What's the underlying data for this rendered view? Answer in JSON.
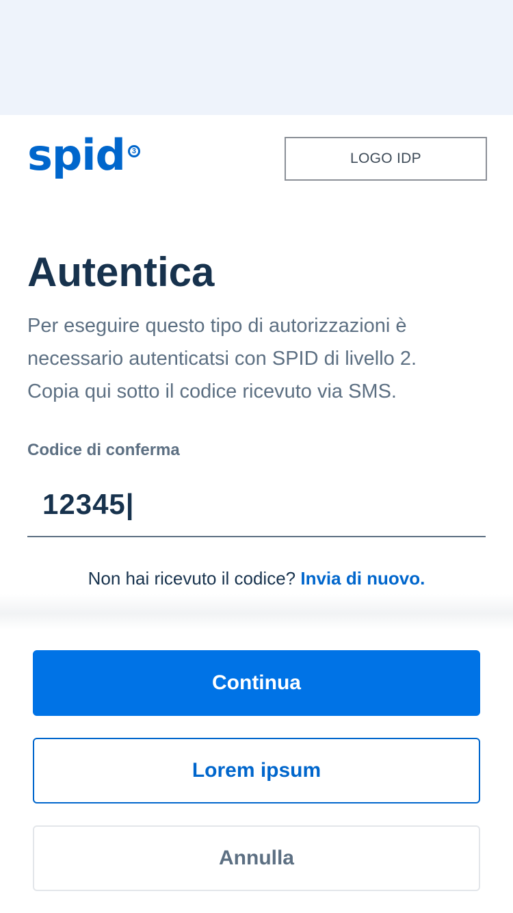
{
  "header": {
    "spid_logo_text": "spid",
    "spid_level": "3",
    "idp_logo_label": "LOGO IDP"
  },
  "main": {
    "title": "Autentica",
    "description": "Per eseguire questo tipo di autorizzazioni è necessario autenticatsi con SPID di livello 2. Copia qui sotto il codice ricevuto via SMS.",
    "code_field": {
      "label": "Codice di conferma",
      "value": "12345|"
    },
    "resend": {
      "text": "Non hai ricevuto il codice?",
      "link_label": "Invia di nuovo."
    }
  },
  "actions": {
    "continue_label": "Continua",
    "secondary_label": "Lorem ipsum",
    "cancel_label": "Annulla"
  },
  "colors": {
    "brand_blue": "#0066cc",
    "primary_button": "#0073e6",
    "heading": "#17324d",
    "body_text": "#5c6f82",
    "top_band": "#eef3fb"
  }
}
